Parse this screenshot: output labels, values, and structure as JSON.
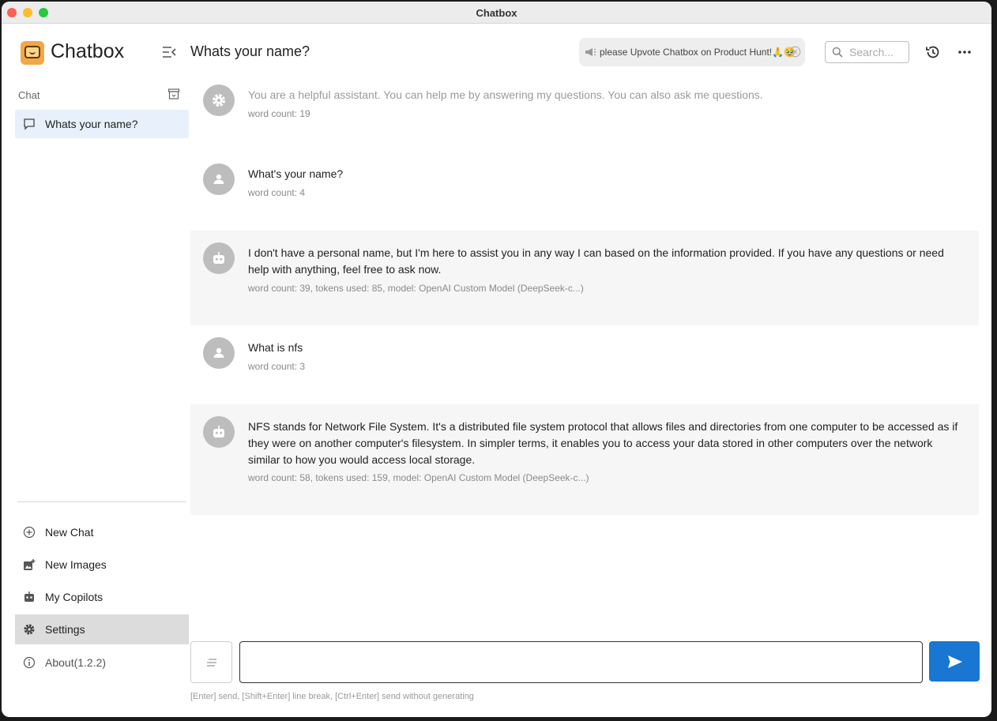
{
  "window": {
    "title": "Chatbox"
  },
  "sidebar": {
    "app_name": "Chatbox",
    "section_label": "Chat",
    "chats": [
      {
        "label": "Whats your name?",
        "active": true
      }
    ],
    "nav": [
      {
        "label": "New Chat",
        "icon": "plus-circle-icon"
      },
      {
        "label": "New Images",
        "icon": "add-image-icon"
      },
      {
        "label": "My Copilots",
        "icon": "robot-icon"
      },
      {
        "label": "Settings",
        "icon": "gear-icon",
        "active": true
      },
      {
        "label": "About(1.2.2)",
        "icon": "info-icon"
      }
    ]
  },
  "header": {
    "title": "Whats your name?",
    "promo_text": "please Upvote Chatbox on Product Hunt!🙏🥹",
    "search_placeholder": "Search..."
  },
  "messages": [
    {
      "role": "system",
      "text": "You are a helpful assistant. You can help me by answering my questions. You can also ask me questions.",
      "meta": "word count: 19"
    },
    {
      "role": "user",
      "text": "What's your name?",
      "meta": "word count: 4"
    },
    {
      "role": "assistant",
      "text": "I don't have a personal name, but I'm here to assist you in any way I can based on the information provided. If you have any questions or need help with anything, feel free to ask now.",
      "meta": "word count: 39, tokens used: 85, model: OpenAI Custom Model (DeepSeek-c...)"
    },
    {
      "role": "user",
      "text": "What is nfs",
      "meta": "word count: 3"
    },
    {
      "role": "assistant",
      "text": "NFS stands for Network File System. It's a distributed file system protocol that allows files and directories from one computer to be accessed as if they were on another computer's filesystem. In simpler terms, it enables you to access your data stored in other computers over the network similar to how you would access local storage.",
      "meta": "word count: 58, tokens used: 159, model: OpenAI Custom Model (DeepSeek-c...)"
    }
  ],
  "composer": {
    "value": "",
    "hint": "[Enter] send, [Shift+Enter] line break, [Ctrl+Enter] send without generating"
  },
  "colors": {
    "accent": "#1976d2",
    "active_chat_bg": "#e8f0fb",
    "active_nav_bg": "#dcdcdc",
    "assistant_bg": "#f6f6f6",
    "avatar_bg": "#bdbdbd"
  }
}
